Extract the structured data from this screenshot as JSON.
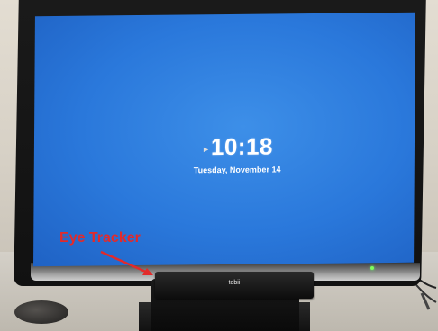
{
  "lock_screen": {
    "time": "10:18",
    "date": "Tuesday, November 14"
  },
  "device": {
    "tracker_brand": "tobii"
  },
  "annotation": {
    "label": "Eye Tracker",
    "color": "#e32a2a"
  },
  "colors": {
    "screen_blue": "#2a78db",
    "led_green": "#7dfc5a"
  }
}
